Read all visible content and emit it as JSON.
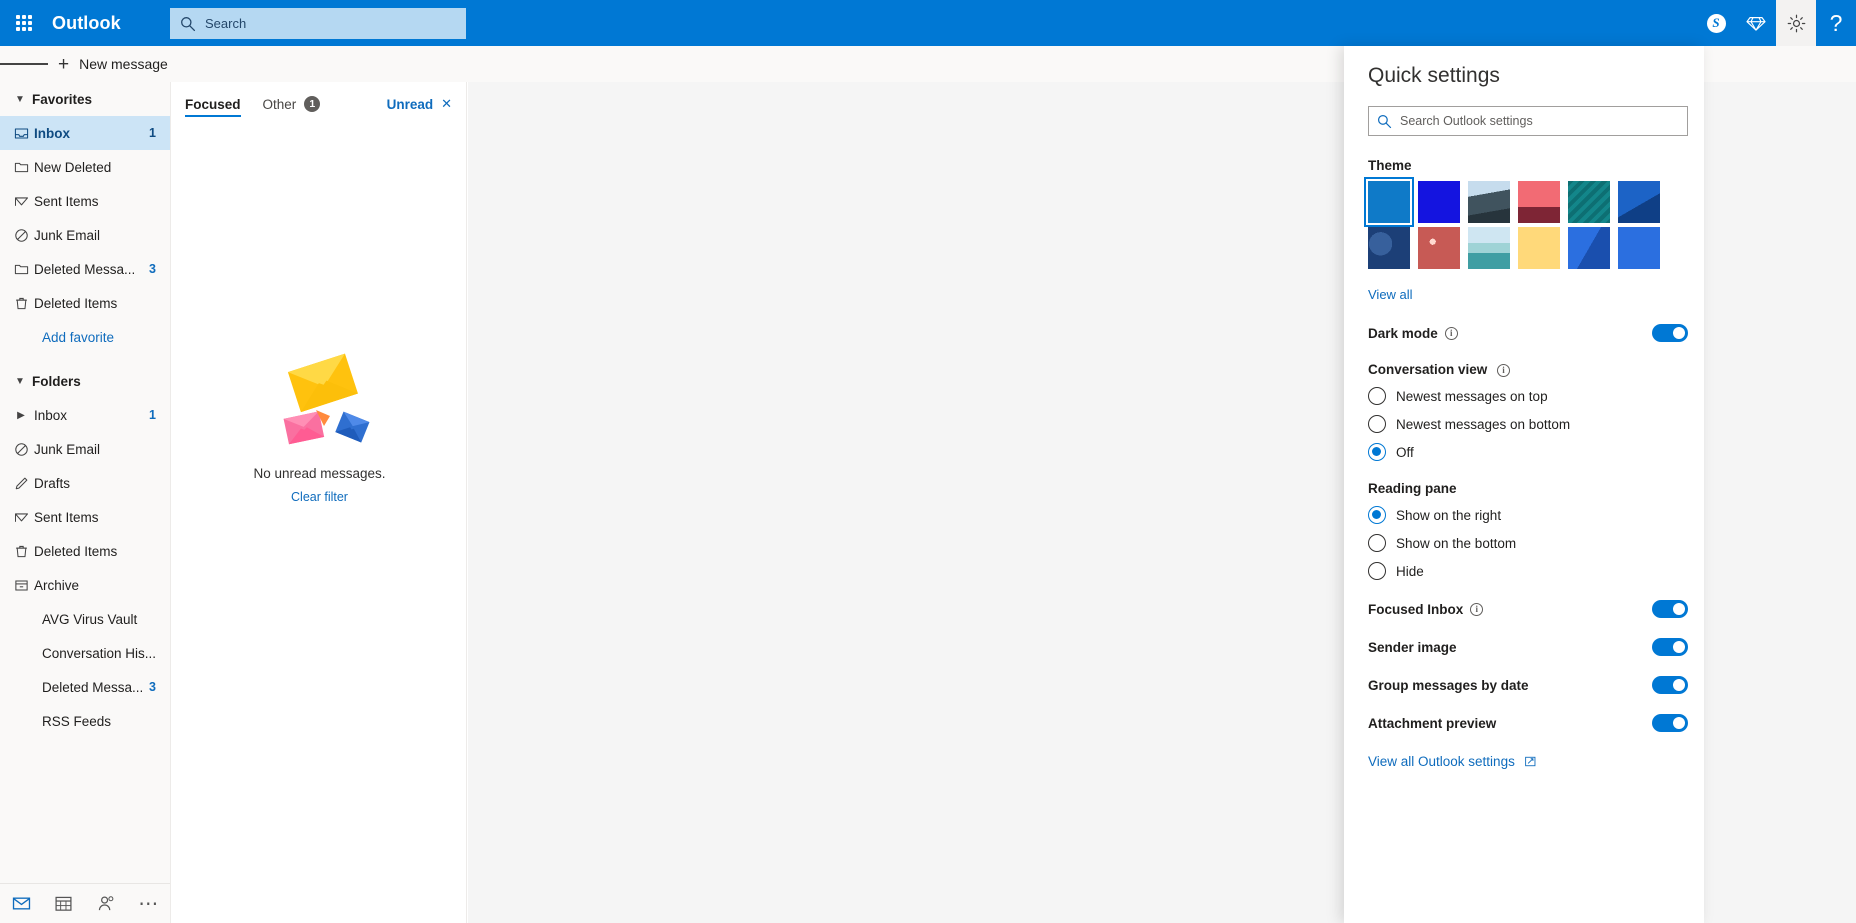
{
  "header": {
    "waffle_icon": "waffle-grid-icon",
    "brand": "Outlook",
    "search_placeholder": "Search",
    "search_icon": "search-icon",
    "skype_icon": "skype-icon",
    "skype_label": "S",
    "diamond_icon": "diamond-icon",
    "settings_icon": "gear-icon",
    "help_icon": "question-mark-icon",
    "help_label": "?",
    "accent_color": "#0078d4",
    "search_bg": "#b5d8f2"
  },
  "commandbar": {
    "hamburger_icon": "hamburger-icon",
    "new_message_label": "New message",
    "plus_icon": "plus-icon",
    "plus_label": "+"
  },
  "sidebar": {
    "favorites": {
      "label": "Favorites",
      "chevron_icon": "chevron-down-icon",
      "items": [
        {
          "label": "Inbox",
          "count": "1",
          "icon": "inbox-icon",
          "selected": true
        },
        {
          "label": "New Deleted",
          "count": "",
          "icon": "folder-icon",
          "selected": false
        },
        {
          "label": "Sent Items",
          "count": "",
          "icon": "send-icon",
          "selected": false
        },
        {
          "label": "Junk Email",
          "count": "",
          "icon": "block-icon",
          "selected": false
        },
        {
          "label": "Deleted Messa...",
          "count": "3",
          "icon": "folder-icon",
          "selected": false
        },
        {
          "label": "Deleted Items",
          "count": "",
          "icon": "trash-icon",
          "selected": false
        }
      ],
      "add_favorite_label": "Add favorite"
    },
    "folders": {
      "label": "Folders",
      "chevron_icon": "chevron-down-icon",
      "items": [
        {
          "label": "Inbox",
          "count": "1",
          "icon": "chevron-right-icon",
          "selected": false
        },
        {
          "label": "Junk Email",
          "count": "",
          "icon": "block-icon",
          "selected": false
        },
        {
          "label": "Drafts",
          "count": "",
          "icon": "pencil-icon",
          "selected": false
        },
        {
          "label": "Sent Items",
          "count": "",
          "icon": "send-icon",
          "selected": false
        },
        {
          "label": "Deleted Items",
          "count": "",
          "icon": "trash-icon",
          "selected": false
        },
        {
          "label": "Archive",
          "count": "",
          "icon": "archive-icon",
          "selected": false
        },
        {
          "label": "AVG Virus Vault",
          "count": "",
          "icon": "",
          "selected": false
        },
        {
          "label": "Conversation His...",
          "count": "",
          "icon": "",
          "selected": false
        },
        {
          "label": "Deleted Messa...",
          "count": "3",
          "icon": "",
          "selected": false
        },
        {
          "label": "RSS Feeds",
          "count": "",
          "icon": "",
          "selected": false
        }
      ]
    },
    "appbar": [
      {
        "name": "mail-icon",
        "selected": true
      },
      {
        "name": "calendar-icon",
        "selected": false
      },
      {
        "name": "people-icon",
        "selected": false
      },
      {
        "name": "more-icon",
        "selected": false
      }
    ]
  },
  "messagelist": {
    "tabs": [
      {
        "label": "Focused",
        "badge": "",
        "active": true
      },
      {
        "label": "Other",
        "badge": "1",
        "active": false
      }
    ],
    "unread_filter_label": "Unread",
    "unread_filter_close": "✕",
    "empty_illustration": "envelopes-illustration",
    "empty_text": "No unread messages.",
    "clear_filter_label": "Clear filter"
  },
  "quicksettings": {
    "title": "Quick settings",
    "search_placeholder": "Search Outlook settings",
    "search_icon": "search-icon",
    "theme_label": "Theme",
    "themes": [
      {
        "name": "theme-default-blue",
        "selected": true
      },
      {
        "name": "theme-solid-blue",
        "selected": false
      },
      {
        "name": "theme-mountain-road",
        "selected": false
      },
      {
        "name": "theme-palm-sunset",
        "selected": false
      },
      {
        "name": "theme-circuit-teal",
        "selected": false
      },
      {
        "name": "theme-blue-ocean-edge",
        "selected": false
      },
      {
        "name": "theme-navy-blueprint",
        "selected": false
      },
      {
        "name": "theme-red-lights",
        "selected": false
      },
      {
        "name": "theme-beach-wave",
        "selected": false
      },
      {
        "name": "theme-gold-star",
        "selected": false
      },
      {
        "name": "theme-blue-swirl",
        "selected": false
      },
      {
        "name": "theme-extra",
        "selected": false
      }
    ],
    "view_all_label": "View all",
    "dark_mode": {
      "label": "Dark mode",
      "info_icon": "info-icon",
      "on": true
    },
    "conversation_view": {
      "label": "Conversation view",
      "info_icon": "info-icon",
      "options": [
        {
          "label": "Newest messages on top",
          "selected": false
        },
        {
          "label": "Newest messages on bottom",
          "selected": false
        },
        {
          "label": "Off",
          "selected": true
        }
      ]
    },
    "reading_pane": {
      "label": "Reading pane",
      "options": [
        {
          "label": "Show on the right",
          "selected": true
        },
        {
          "label": "Show on the bottom",
          "selected": false
        },
        {
          "label": "Hide",
          "selected": false
        }
      ]
    },
    "toggles": [
      {
        "label": "Focused Inbox",
        "info_icon": "info-icon",
        "on": true
      },
      {
        "label": "Sender image",
        "info_icon": "",
        "on": true
      },
      {
        "label": "Group messages by date",
        "info_icon": "",
        "on": true
      },
      {
        "label": "Attachment preview",
        "info_icon": "",
        "on": true
      }
    ],
    "view_all_settings_label": "View all Outlook settings",
    "view_all_settings_icon": "open-in-new-icon"
  }
}
